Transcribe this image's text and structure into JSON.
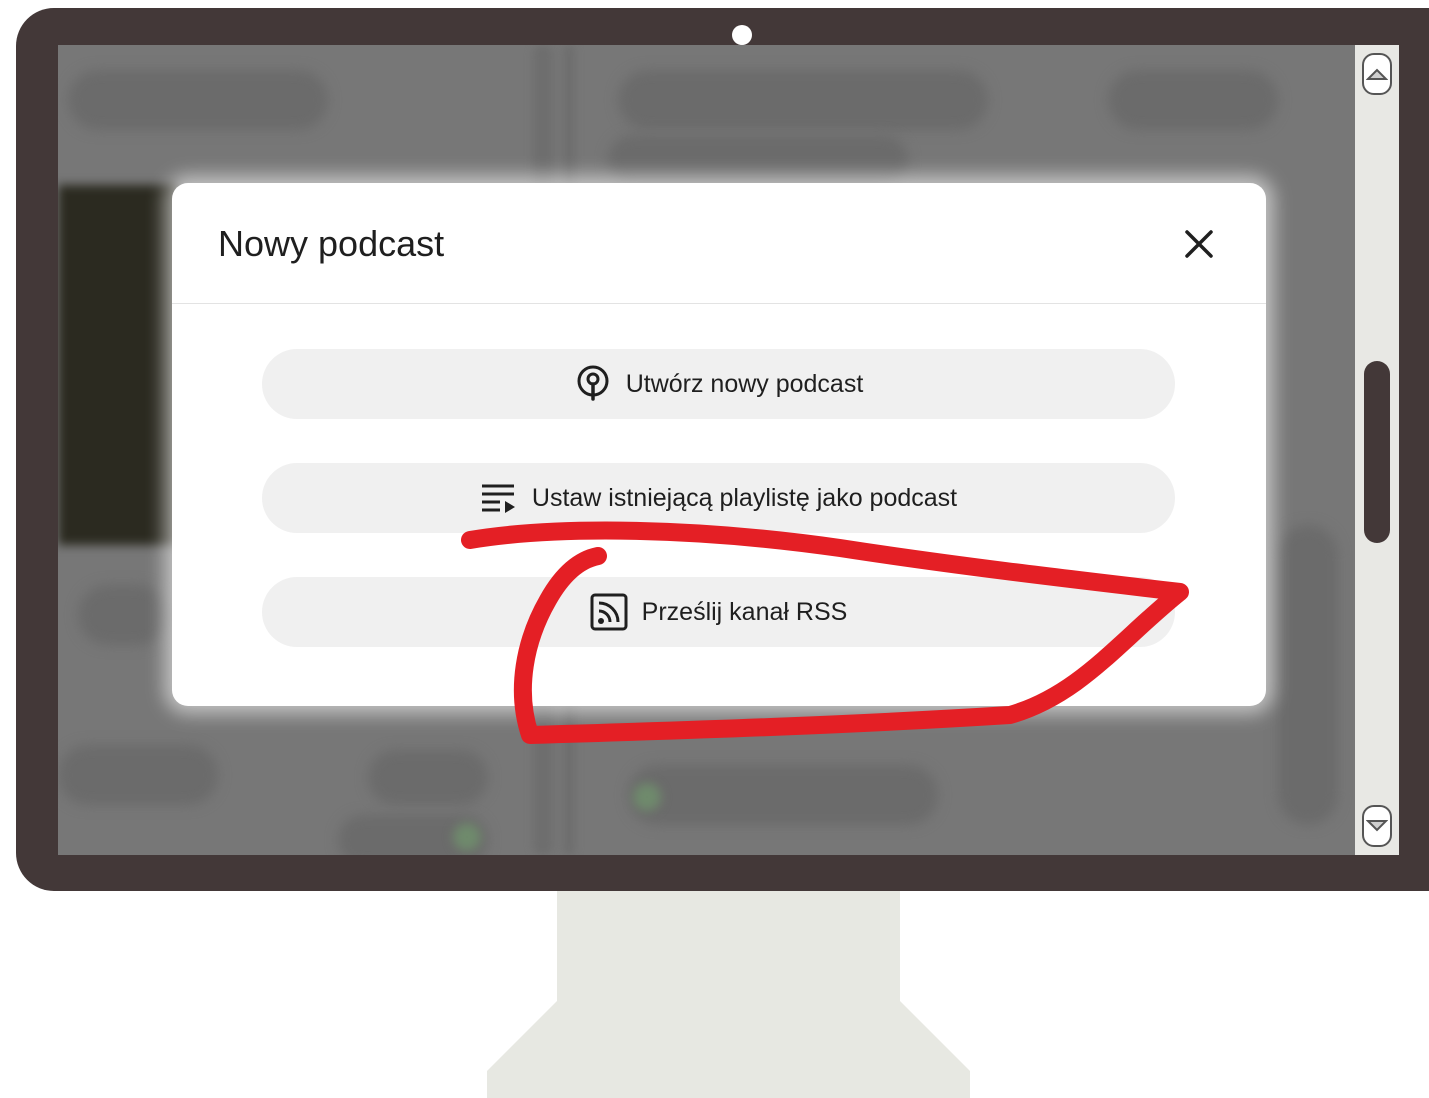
{
  "dialog": {
    "title": "Nowy podcast",
    "close_icon": "close-icon",
    "options": [
      {
        "label": "Utwórz nowy podcast",
        "icon": "podcast-icon"
      },
      {
        "label": "Ustaw istniejącą playlistę jako podcast",
        "icon": "playlist-play-icon"
      },
      {
        "label": "Prześlij kanał RSS",
        "icon": "rss-feed-icon"
      }
    ]
  },
  "annotation": {
    "color": "#e41f25"
  },
  "colors": {
    "monitor_frame": "#433838",
    "stand": "#e7e8e2",
    "overlay": "#777777",
    "option_bg": "#f0f0f0"
  }
}
